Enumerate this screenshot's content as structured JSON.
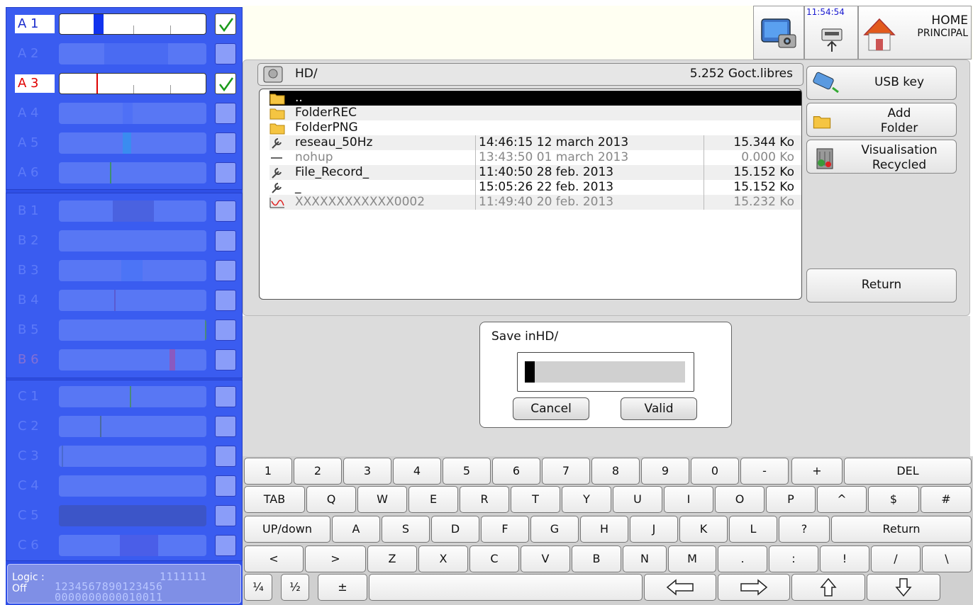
{
  "topbar": {
    "clock": "11:54:54",
    "home_line1": "HOME",
    "home_line2": "PRINCIPAL"
  },
  "channels": {
    "group_a": [
      {
        "label": "A 1",
        "active": true,
        "color": "#1a2ccc"
      },
      {
        "label": "A 2",
        "active": false
      },
      {
        "label": "A 3",
        "active": true,
        "color": "#e00000"
      },
      {
        "label": "A 4",
        "active": false
      },
      {
        "label": "A 5",
        "active": false
      },
      {
        "label": "A 6",
        "active": false
      }
    ],
    "group_b": [
      "B 1",
      "B 2",
      "B 3",
      "B 4",
      "B 5",
      "B 6"
    ],
    "group_c": [
      "C 1",
      "C 2",
      "C 3",
      "C 4",
      "C 5",
      "C 6"
    ]
  },
  "logic": {
    "label": "Logic :\nOff",
    "top_digits": "1111111",
    "index_digits": "1234567890123456",
    "state_digits": "0000000000010011"
  },
  "browser": {
    "path": "HD/",
    "free_space": "5.252 Goct.libres",
    "files": [
      {
        "name": "..",
        "date": "",
        "size": "",
        "icon": "folder-up-icon"
      },
      {
        "name": "FolderREC",
        "date": "",
        "size": "",
        "icon": "folder-icon"
      },
      {
        "name": "FolderPNG",
        "date": "",
        "size": "",
        "icon": "folder-icon"
      },
      {
        "name": "reseau_50Hz",
        "date": "14:46:15 12 march 2013",
        "size": "15.344 Ko",
        "icon": "wrench-icon"
      },
      {
        "name": "nohup",
        "date": "13:43:50 01 march 2013",
        "size": "0.000 Ko",
        "icon": "dash-icon"
      },
      {
        "name": "File_Record_",
        "date": "11:40:50 28 feb. 2013",
        "size": "15.152 Ko",
        "icon": "wrench-icon"
      },
      {
        "name": "_",
        "date": "15:05:26 22 feb. 2013",
        "size": "15.152 Ko",
        "icon": "wrench-icon"
      },
      {
        "name": "XXXXXXXXXXXX0002",
        "date": "11:49:40 20 feb. 2013",
        "size": "15.232 Ko",
        "icon": "waveform-icon"
      }
    ],
    "side_buttons": {
      "usb": "USB key",
      "add_folder_1": "Add",
      "add_folder_2": "Folder",
      "recycled_1": "Visualisation",
      "recycled_2": "Recycled",
      "return": "Return"
    }
  },
  "dialog": {
    "title": "Save inHD/",
    "input_value": "",
    "cancel": "Cancel",
    "valid": "Valid"
  },
  "keyboard": {
    "row1": [
      "1",
      "2",
      "3",
      "4",
      "5",
      "6",
      "7",
      "8",
      "9",
      "0",
      "-",
      "+",
      "DEL"
    ],
    "row2": [
      "TAB",
      "Q",
      "W",
      "E",
      "R",
      "T",
      "Y",
      "U",
      "I",
      "O",
      "P",
      "^",
      "$",
      "#"
    ],
    "row3": [
      "UP/down",
      "A",
      "S",
      "D",
      "F",
      "G",
      "H",
      "J",
      "K",
      "L",
      "?",
      "Return"
    ],
    "row4": [
      "<",
      ">",
      "Z",
      "X",
      "C",
      "V",
      "B",
      "N",
      "M",
      ".",
      ":",
      "!",
      "/",
      "\\"
    ],
    "row5": [
      "¼",
      "½",
      "±"
    ]
  }
}
